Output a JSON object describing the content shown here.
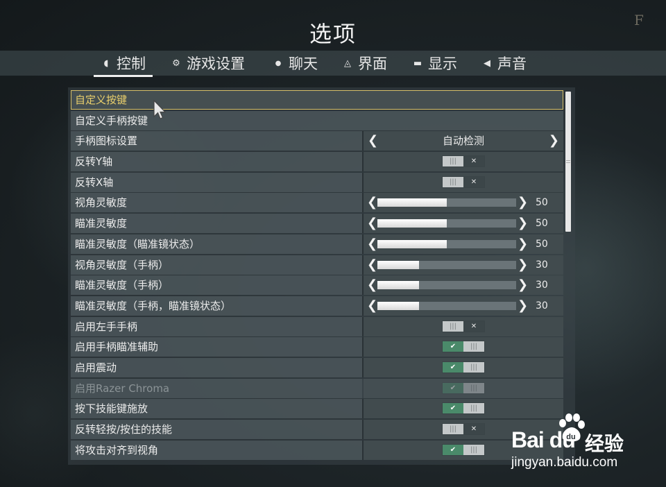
{
  "window": {
    "title": "选项",
    "corner_logo": "F"
  },
  "tabs": [
    {
      "label": "控制",
      "icon": "mouse-icon",
      "glyph": "◖",
      "active": true
    },
    {
      "label": "游戏设置",
      "icon": "gear-icon",
      "glyph": "⚙",
      "active": false
    },
    {
      "label": "聊天",
      "icon": "chat-bubble-icon",
      "glyph": "●",
      "active": false
    },
    {
      "label": "界面",
      "icon": "interface-icon",
      "glyph": "◬",
      "active": false
    },
    {
      "label": "显示",
      "icon": "monitor-icon",
      "glyph": "▬",
      "active": false
    },
    {
      "label": "声音",
      "icon": "speaker-icon",
      "glyph": "◀",
      "active": false
    }
  ],
  "settings": {
    "custom_keys": "自定义按键",
    "custom_gamepad_keys": "自定义手柄按键",
    "gamepad_icon": {
      "label": "手柄图标设置",
      "value": "自动检测"
    },
    "invert_y": {
      "label": "反转Y轴",
      "state": "off"
    },
    "invert_x": {
      "label": "反转X轴",
      "state": "off"
    },
    "view_sensitivity": {
      "label": "视角灵敏度",
      "value": 50
    },
    "aim_sensitivity": {
      "label": "瞄准灵敏度",
      "value": 50
    },
    "aim_sensitivity_scope": {
      "label": "瞄准灵敏度（瞄准镜状态）",
      "value": 50
    },
    "view_sensitivity_gamepad": {
      "label": "视角灵敏度（手柄）",
      "value": 30
    },
    "aim_sensitivity_gamepad": {
      "label": "瞄准灵敏度（手柄）",
      "value": 30
    },
    "aim_sensitivity_gamepad_scope": {
      "label": "瞄准灵敏度（手柄，瞄准镜状态）",
      "value": 30
    },
    "left_handed_gamepad": {
      "label": "启用左手手柄",
      "state": "off"
    },
    "gamepad_aim_assist": {
      "label": "启用手柄瞄准辅助",
      "state": "on"
    },
    "vibration": {
      "label": "启用震动",
      "state": "on"
    },
    "razer_chroma": {
      "label": "启用Razer Chroma",
      "state": "on",
      "disabled": true
    },
    "cast_on_press": {
      "label": "按下技能键施放",
      "state": "on"
    },
    "invert_tap_hold": {
      "label": "反转轻按/按住的技能",
      "state": "off"
    },
    "align_attack_view": {
      "label": "将攻击对齐到视角",
      "state": "on"
    }
  },
  "toggle_glyphs": {
    "on_mark": "✔",
    "off_mark": "✕",
    "grip": "|||"
  },
  "arrows": {
    "left": "❮",
    "right": "❯"
  },
  "watermark": {
    "brand": "Bai du",
    "brand_cn": "经验",
    "url": "jingyan.baidu.com"
  },
  "colors": {
    "accent_selected": "#d7c06a",
    "toggle_on": "#4a8a6a",
    "slider_fill": "#ffffff"
  }
}
